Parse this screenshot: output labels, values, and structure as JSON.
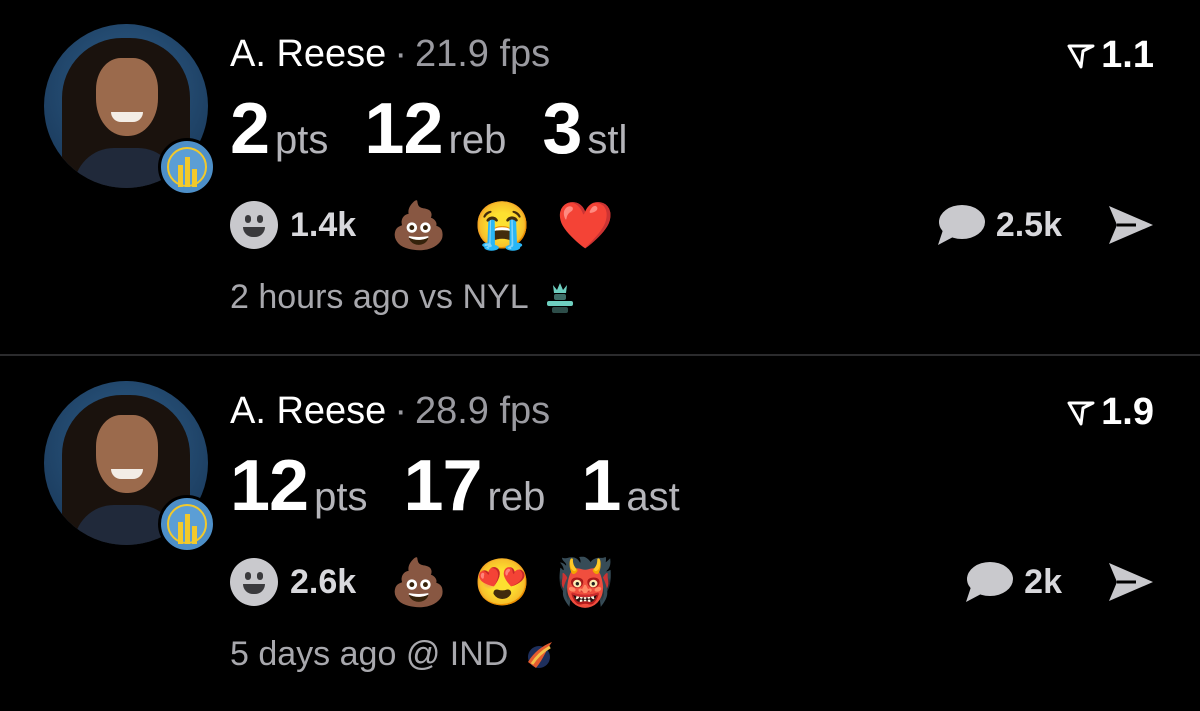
{
  "colors": {
    "background": "#000000",
    "muted": "#9a9aa0",
    "divider": "#2b2b2d"
  },
  "posts": [
    {
      "player": "A. Reese",
      "fps": "21.9 fps",
      "rating": "1.1",
      "stats": [
        {
          "value": "2",
          "unit": "pts"
        },
        {
          "value": "12",
          "unit": "reb"
        },
        {
          "value": "3",
          "unit": "stl"
        }
      ],
      "reaction_count": "1.4k",
      "reaction_emojis": [
        "💩",
        "😭",
        "❤️"
      ],
      "comment_count": "2.5k",
      "time": "2 hours ago",
      "matchup": "vs NYL",
      "opponent_logo_icon": "liberty-logo-icon"
    },
    {
      "player": "A. Reese",
      "fps": "28.9 fps",
      "rating": "1.9",
      "stats": [
        {
          "value": "12",
          "unit": "pts"
        },
        {
          "value": "17",
          "unit": "reb"
        },
        {
          "value": "1",
          "unit": "ast"
        }
      ],
      "reaction_count": "2.6k",
      "reaction_emojis": [
        "💩",
        "😍",
        "👹"
      ],
      "comment_count": "2k",
      "time": "5 days ago",
      "matchup": "@ IND",
      "opponent_logo_icon": "fever-logo-icon"
    }
  ]
}
